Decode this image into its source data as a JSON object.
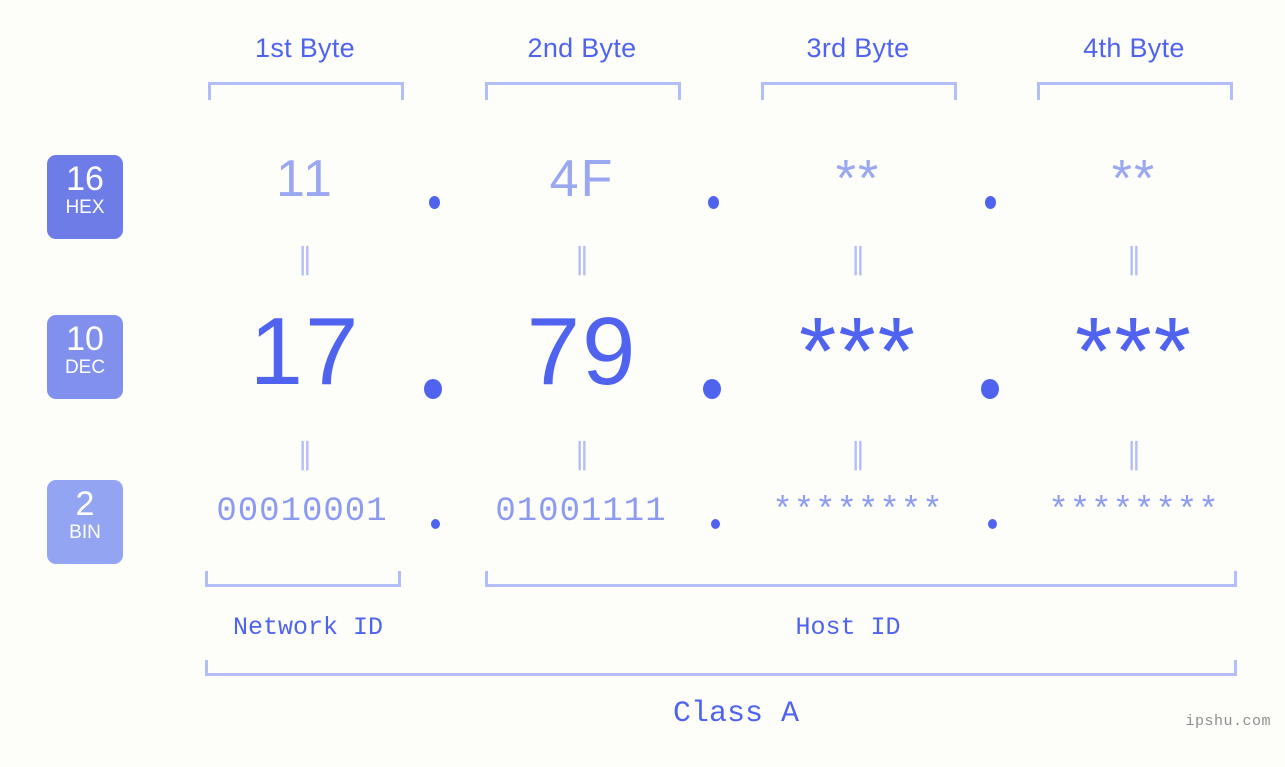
{
  "watermark": "ipshu.com",
  "colors": {
    "background": "#fdfefa",
    "accent_strong": "#4f63ef",
    "accent_mid": "#8190ed",
    "accent_light": "#9aa7f1",
    "bracket": "#b3bdf7",
    "badge_hex": "#6e7ce8",
    "badge_dec": "#8190ed",
    "badge_bin": "#93a4f3",
    "watermark": "#8f8f8f"
  },
  "byte_headers": [
    {
      "label": "1st Byte"
    },
    {
      "label": "2nd Byte"
    },
    {
      "label": "3rd Byte"
    },
    {
      "label": "4th Byte"
    }
  ],
  "bases": [
    {
      "id": "hex",
      "number": "16",
      "abbr": "HEX"
    },
    {
      "id": "dec",
      "number": "10",
      "abbr": "DEC"
    },
    {
      "id": "bin",
      "number": "2",
      "abbr": "BIN"
    }
  ],
  "rows": {
    "hex": {
      "base_number": "16",
      "base_abbr": "HEX",
      "values": [
        "11",
        "4F",
        "**",
        "**"
      ],
      "separator": "."
    },
    "dec": {
      "base_number": "10",
      "base_abbr": "DEC",
      "values": [
        "17",
        "79",
        "***",
        "***"
      ],
      "separator": "."
    },
    "bin": {
      "base_number": "2",
      "base_abbr": "BIN",
      "values": [
        "00010001",
        "01001111",
        "********",
        "********"
      ],
      "separator": "."
    }
  },
  "equivalence_marks": {
    "hex_to_dec": [
      "=",
      "=",
      "=",
      "="
    ],
    "dec_to_bin": [
      "=",
      "=",
      "=",
      "="
    ]
  },
  "sections": [
    {
      "label": "Network ID"
    },
    {
      "label": "Host ID"
    },
    {
      "label": "Class A"
    }
  ]
}
